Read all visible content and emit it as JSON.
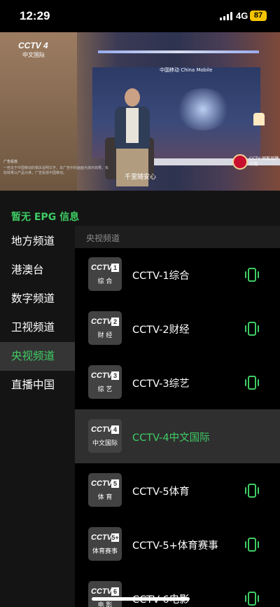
{
  "status_bar": {
    "time": "12:29",
    "network": "4G",
    "battery": "87",
    "icons": [
      "signal-icon",
      "battery-icon"
    ]
  },
  "video": {
    "channel_logo": "CCTV 4",
    "channel_logo_sub": "中文国际",
    "sponsor_logo": "中国移动 China Mobile",
    "caption": "千里随安心",
    "ad_tag": "广告投放",
    "fine_print": "一些关于中国移动的相关说明文字，本广告中的画面为演示效果，实际效果以产品为准，广告投放中国移动。",
    "badge_text": "CCTV 国家品牌计划"
  },
  "epg": {
    "text": "暂无 EPG 信息"
  },
  "sidebar": {
    "items": [
      {
        "label": "地方频道"
      },
      {
        "label": "港澳台"
      },
      {
        "label": "数字频道"
      },
      {
        "label": "卫视频道"
      },
      {
        "label": "央视频道",
        "active": true
      },
      {
        "label": "直播中国"
      }
    ]
  },
  "list": {
    "header": "央视频道",
    "channels": [
      {
        "name": "CCTV-1综合",
        "logo_num": "1",
        "logo_sub": "综 合",
        "active": false
      },
      {
        "name": "CCTV-2财经",
        "logo_num": "2",
        "logo_sub": "财 经",
        "active": false
      },
      {
        "name": "CCTV-3综艺",
        "logo_num": "3",
        "logo_sub": "综 艺",
        "active": false
      },
      {
        "name": "CCTV-4中文国际",
        "logo_num": "4",
        "logo_sub": "中文国际",
        "active": true
      },
      {
        "name": "CCTV-5体育",
        "logo_num": "5",
        "logo_sub": "体 育",
        "active": false
      },
      {
        "name": "CCTV-5+体育赛事",
        "logo_num": "5+",
        "logo_sub": "体育赛事",
        "active": false
      },
      {
        "name": "CCTV-6电影",
        "logo_num": "6",
        "logo_sub": "电 影",
        "active": false
      }
    ],
    "logo_brand": "CCTV",
    "row_icon": "phone-vibrate-icon"
  },
  "colors": {
    "accent": "#3fcc64",
    "battery": "#f5c400",
    "sidebar_bg": "#141414",
    "active_bg": "#353535"
  }
}
